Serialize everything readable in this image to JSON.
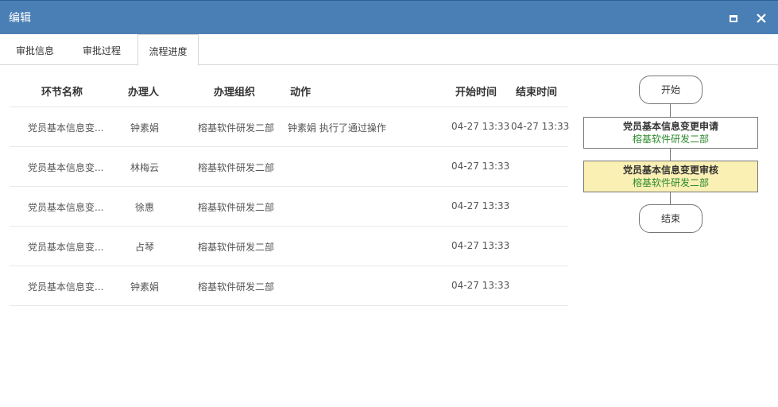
{
  "window": {
    "title": "编辑"
  },
  "tabs": [
    {
      "label": "审批信息"
    },
    {
      "label": "审批过程"
    },
    {
      "label": "流程进度"
    }
  ],
  "table": {
    "headers": [
      "环节名称",
      "办理人",
      "办理组织",
      "动作",
      "开始时间",
      "结束时间"
    ],
    "rows": [
      {
        "node": "党员基本信息变...",
        "handler": "钟素娟",
        "org": "榕基软件研发二部",
        "action": "钟素娟 执行了通过操作",
        "start": "04-27 13:33",
        "end": "04-27 13:33"
      },
      {
        "node": "党员基本信息变...",
        "handler": "林梅云",
        "org": "榕基软件研发二部",
        "action": "",
        "start": "04-27 13:33",
        "end": ""
      },
      {
        "node": "党员基本信息变...",
        "handler": "徐惠",
        "org": "榕基软件研发二部",
        "action": "",
        "start": "04-27 13:33",
        "end": ""
      },
      {
        "node": "党员基本信息变...",
        "handler": "占琴",
        "org": "榕基软件研发二部",
        "action": "",
        "start": "04-27 13:33",
        "end": ""
      },
      {
        "node": "党员基本信息变...",
        "handler": "钟素娟",
        "org": "榕基软件研发二部",
        "action": "",
        "start": "04-27 13:33",
        "end": ""
      }
    ]
  },
  "flow": {
    "start": "开始",
    "steps": [
      {
        "title": "党员基本信息变更申请",
        "org": "榕基软件研发二部",
        "current": false
      },
      {
        "title": "党员基本信息变更审核",
        "org": "榕基软件研发二部",
        "current": true
      }
    ],
    "end": "结束"
  },
  "colors": {
    "titlebar": "#4a7fb5",
    "current_step": "#faf0b4",
    "org_text": "#2c8a2c"
  }
}
